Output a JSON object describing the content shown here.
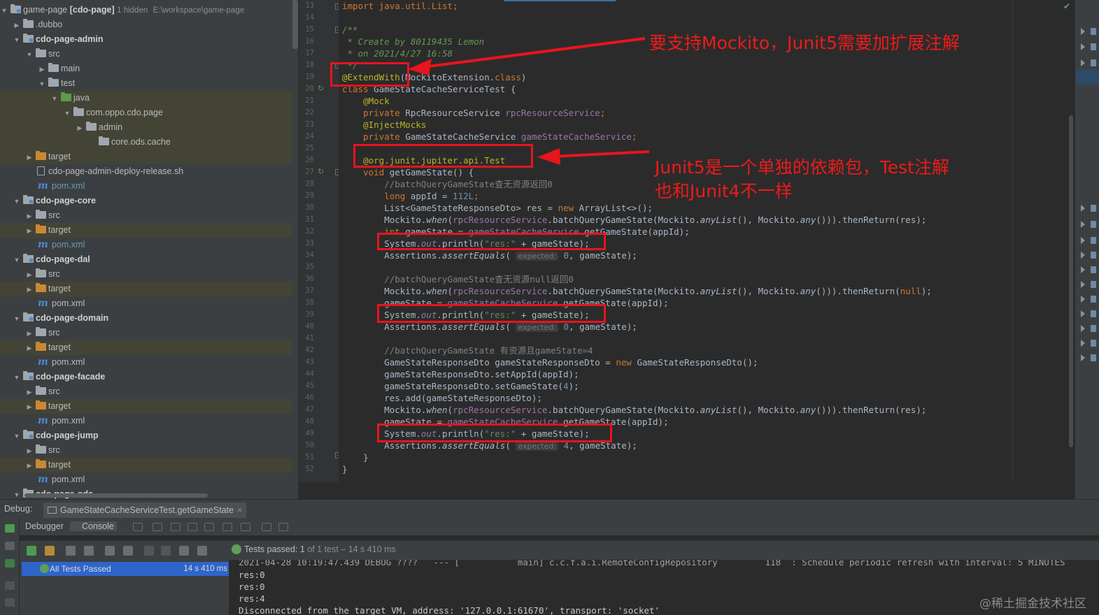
{
  "tree": {
    "items": [
      {
        "label": "game-page",
        "extra": "[cdo-page]",
        "hidden": "1 hidden",
        "path": "E:\\workspace\\game-page"
      },
      {
        "label": ".dubbo"
      },
      {
        "label": "cdo-page-admin"
      },
      {
        "label": "src"
      },
      {
        "label": "main"
      },
      {
        "label": "test"
      },
      {
        "label": "java"
      },
      {
        "label": "com.oppo.cdo.page"
      },
      {
        "label": "admin"
      },
      {
        "label": "core.ods.cache"
      },
      {
        "label": "target"
      },
      {
        "label": "cdo-page-admin-deploy-release.sh"
      },
      {
        "label": "pom.xml"
      },
      {
        "label": "cdo-page-core"
      },
      {
        "label": "src"
      },
      {
        "label": "target"
      },
      {
        "label": "pom.xml"
      },
      {
        "label": "cdo-page-dal"
      },
      {
        "label": "src"
      },
      {
        "label": "target"
      },
      {
        "label": "pom.xml"
      },
      {
        "label": "cdo-page-domain"
      },
      {
        "label": "src"
      },
      {
        "label": "target"
      },
      {
        "label": "pom.xml"
      },
      {
        "label": "cdo-page-facade"
      },
      {
        "label": "src"
      },
      {
        "label": "target"
      },
      {
        "label": "pom.xml"
      },
      {
        "label": "cdo-page-jump"
      },
      {
        "label": "src"
      },
      {
        "label": "target"
      },
      {
        "label": "pom.xml"
      },
      {
        "label": "cdo-page-ods"
      }
    ]
  },
  "editor": {
    "line_numbers": [
      "13",
      "14",
      "15",
      "16",
      "17",
      "18",
      "19",
      "20",
      "21",
      "22",
      "23",
      "24",
      "25",
      "26",
      "27",
      "28",
      "29",
      "30",
      "31",
      "32",
      "33",
      "34",
      "35",
      "36",
      "37",
      "38",
      "39",
      "40",
      "41",
      "42",
      "43",
      "44",
      "45",
      "46",
      "47",
      "48",
      "49",
      "50",
      "51",
      "52"
    ],
    "code": {
      "l13": "import java.util.List;",
      "l15": "/**",
      "l16": " * Create by 80119435 Lemon",
      "l17": " * on 2021/4/27 16:58",
      "l18": " */",
      "l19a": "@ExtendWith",
      "l19b": "(MockitoExtension.",
      "l19c": "class",
      "l19d": ")",
      "l20a": "class",
      "l20b": " GameStateCacheServiceTest {",
      "l21": "    @Mock",
      "l22a": "    private",
      "l22b": " RpcResourceService ",
      "l22c": "rpcResourceService",
      "l22d": ";",
      "l23": "    @InjectMocks",
      "l24a": "    private",
      "l24b": " GameStateCacheService ",
      "l24c": "gameStateCacheService",
      "l24d": ";",
      "l26a": "    @org.junit.jupiter.api.",
      "l26b": "Test",
      "l27a": "    void",
      "l27b": " getGameState() {",
      "l28": "        //batchQueryGameState查无资源返回0",
      "l29a": "        long",
      "l29b": " appId = ",
      "l29c": "112L",
      "l29d": ";",
      "l30a": "        List<GameStateResponseDto> res = ",
      "l30b": "new",
      "l30c": " ArrayList<>();",
      "l31a": "        Mockito.",
      "l31b": "when",
      "l31c": "(",
      "l31d": "rpcResourceService",
      "l31e": ".batchQueryGameState(Mockito.",
      "l31f": "anyList",
      "l31g": "(), Mockito.",
      "l31h": "any",
      "l31i": "())).thenReturn(res);",
      "l32a": "        int",
      "l32b": " gameState = ",
      "l32c": "gameStateCacheService",
      "l32d": ".getGameState(appId);",
      "l33a": "        System.",
      "l33b": "out",
      "l33c": ".println(",
      "l33d": "\"res:\"",
      "l33e": " + gameState);",
      "l34a": "        Assertions.",
      "l34b": "assertEquals",
      "l34c": "( ",
      "l34d": "expected:",
      "l34e": " 0",
      "l34f": ", gameState);",
      "l36": "        //batchQueryGameState查无资源null返回0",
      "l37i": "())).thenReturn(",
      "l37j": "null",
      "l37k": ");",
      "l38a": "        gameState = ",
      "l40e": " 0",
      "l42": "        //batchQueryGameState 有资源且gameState=4",
      "l43a": "        GameStateResponseDto gameStateResponseDto = ",
      "l43b": "new",
      "l43c": " GameStateResponseDto();",
      "l44a": "        gameStateResponseDto.setAppId(appId);",
      "l45a": "        gameStateResponseDto.setGameState(",
      "l45b": "4",
      "l45c": ");",
      "l46": "        res.add(gameStateResponseDto);",
      "l50e": " 4",
      "l51": "    }",
      "l52": "}"
    }
  },
  "annotations": {
    "top": "要支持Mockito，Junit5需要加扩展注解",
    "mid1": "Junit5是一个单独的依赖包，Test注解",
    "mid2": "也和Junit4不一样"
  },
  "debug": {
    "label": "Debug:",
    "tab": "GameStateCacheServiceTest.getGameState",
    "close": "×",
    "subtab_debugger": "Debugger",
    "subtab_console": "Console",
    "tests_passed_a": "Tests passed: ",
    "tests_passed_b": "1",
    "tests_passed_c": " of 1 test – 14 s 410 ms",
    "test_row": "All Tests Passed",
    "test_row_duration": "14 s 410 ms",
    "console_lines": [
      "2021-04-28 10:19:47.439 DEBUG ????   --- [           main] c.c.f.a.i.RemoteConfigRepository         118  : Schedule periodic refresh with interval: 5 MINUTES",
      "res:0",
      "res:0",
      "res:4",
      "Disconnected from the target VM, address: '127.0.0.1:61670', transport: 'socket'"
    ]
  },
  "watermark": "@稀土掘金技术社区",
  "colors": {
    "annotation": "#e8141e",
    "selection": "#2f65ca",
    "keyword": "#cc7832",
    "annotation_code": "#bbb529",
    "string": "#6a8759",
    "field": "#9876aa"
  }
}
